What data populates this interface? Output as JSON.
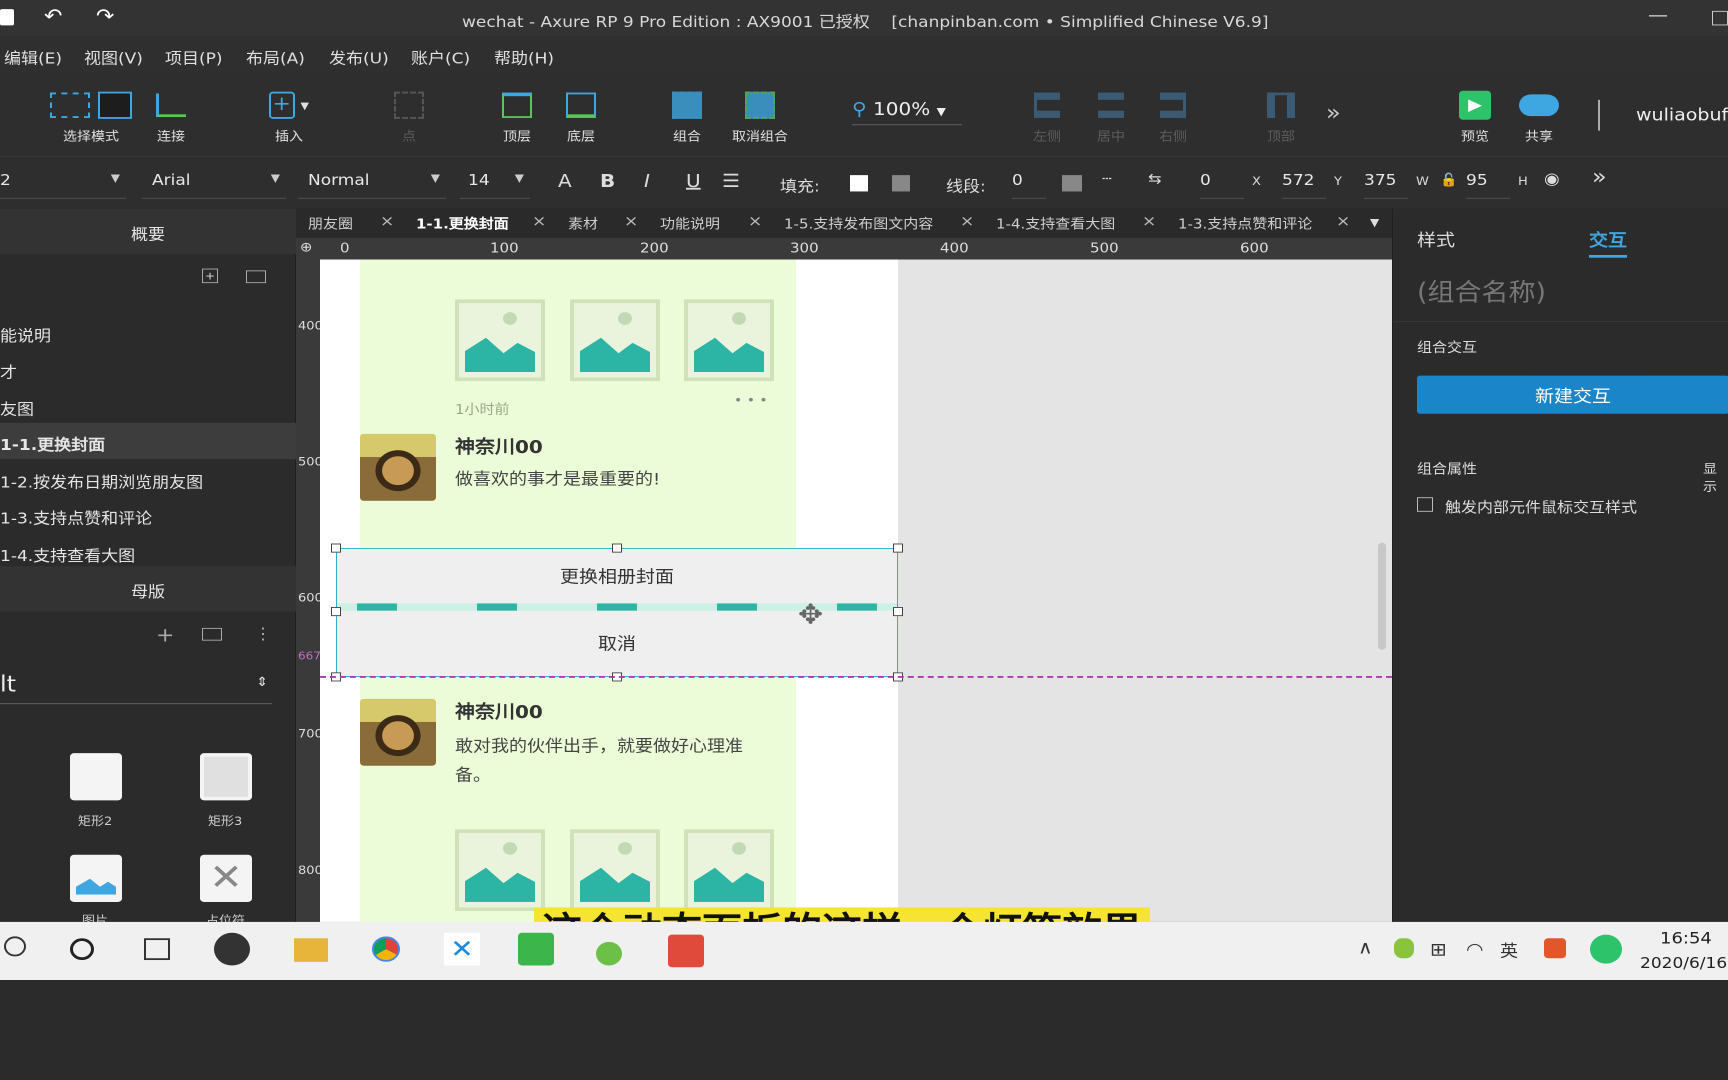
{
  "title": "wechat - Axure RP 9 Pro Edition : AX9001 已授权    [chanpinban.com • Simplified Chinese V6.9]",
  "menu": [
    "编辑(E)",
    "视图(V)",
    "项目(P)",
    "布局(A)",
    "发布(U)",
    "账户(C)",
    "帮助(H)"
  ],
  "toolbar": {
    "select": "选择模式",
    "connect": "连接",
    "insert": "插入",
    "point": "点",
    "top": "顶层",
    "bottom": "底层",
    "group": "组合",
    "ungroup": "取消组合",
    "zoom": "100%",
    "left": "左侧",
    "center": "居中",
    "right": "右侧",
    "top_align": "顶部",
    "preview": "预览",
    "share": "共享",
    "user": "wuliaobuf"
  },
  "stylebar": {
    "style_num": "2",
    "font": "Arial",
    "weight": "Normal",
    "size": "14",
    "fill_label": "填充:",
    "stroke_label": "线段:",
    "stroke_val": "0",
    "x": "0",
    "x_label": "X",
    "y": "572",
    "y_label": "Y",
    "w": "375",
    "w_label": "W",
    "h": "95",
    "h_label": "H"
  },
  "left": {
    "outline_title": "概要",
    "pages": [
      "能说明",
      "才",
      "友图",
      "1-1.更换封面",
      "1-2.按发布日期浏览朋友图",
      "1-3.支持点赞和评论",
      "1-4.支持查看大图"
    ],
    "master_title": "母版",
    "lib": "lt",
    "widgets": [
      "矩形2",
      "矩形3",
      "图片",
      "占位符"
    ]
  },
  "tabs": [
    "朋友圈",
    "1-1.更换封面",
    "素材",
    "功能说明",
    "1-5.支持发布图文内容",
    "1-4.支持查看大图",
    "1-3.支持点赞和评论"
  ],
  "ruler_h": [
    "0",
    "100",
    "200",
    "300",
    "400",
    "500",
    "600"
  ],
  "ruler_v": [
    "400",
    "500",
    "600",
    "667",
    "700",
    "800"
  ],
  "canvas": {
    "time1": "1小时前",
    "dots": "• • •",
    "name1": "神奈川00",
    "text1": "做喜欢的事才是最重要的!",
    "btn1": "更换相册封面",
    "btn2": "取消",
    "name2": "神奈川00",
    "text2a": "敢对我的伙伴出手，就要做好心理准",
    "text2b": "备。"
  },
  "right": {
    "tab_style": "样式",
    "tab_interact": "交互",
    "group_name": "(组合名称)",
    "group_interact": "组合交互",
    "new_btn": "新建交互",
    "group_props": "组合属性",
    "show": "显示",
    "checkbox": "触发内部元件鼠标交互样式"
  },
  "subtitle": "这个动态面板的这样一个灯箱效果",
  "clock": {
    "time": "16:54",
    "date": "2020/6/16"
  }
}
